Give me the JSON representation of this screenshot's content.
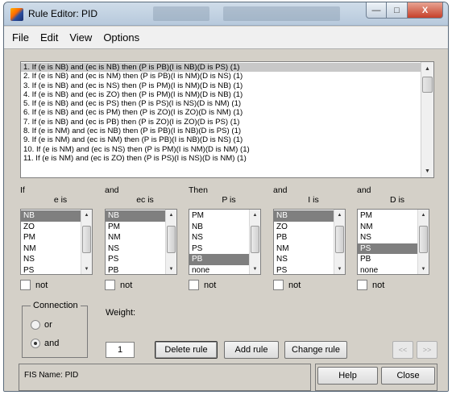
{
  "window": {
    "title": "Rule Editor: PID",
    "buttons": {
      "minimize": "—",
      "maximize": "□",
      "close": "X"
    }
  },
  "menu": [
    "File",
    "Edit",
    "View",
    "Options"
  ],
  "rules": [
    "1. If (e is NB) and (ec is NB) then (P is PB)(I is NB)(D is PS) (1)",
    "2. If (e is NB) and (ec is NM) then (P is PB)(I is NM)(D is NS) (1)",
    "3. If (e is NB) and (ec is NS) then (P is PM)(I is NM)(D is NB) (1)",
    "4. If (e is NB) and (ec is ZO) then (P is PM)(I is NM)(D is NB) (1)",
    "5. If (e is NB) and (ec is PS) then (P is PS)(I is NS)(D is NM) (1)",
    "6. If (e is NB) and (ec is PM) then (P is ZO)(I is ZO)(D is NM) (1)",
    "7. If (e is NB) and (ec is PB) then (P is ZO)(I is ZO)(D is PS) (1)",
    "8. If (e is NM) and (ec is NB) then (P is PB)(I is NB)(D is PS) (1)",
    "9. If (e is NM) and (ec is NM) then (P is PB)(I is NB)(D is NS) (1)",
    "10. If (e is NM) and (ec is NS) then (P is PM)(I is NM)(D is NM) (1)",
    "11. If (e is NM) and (ec is ZO) then (P is PS)(I is NS)(D is NM) (1)"
  ],
  "columns": [
    {
      "head1": "If",
      "head2": "e is",
      "items": [
        "NB",
        "ZO",
        "PM",
        "NM",
        "NS",
        "PS"
      ],
      "selected": 0
    },
    {
      "head1": "and",
      "head2": "ec is",
      "items": [
        "NB",
        "PM",
        "NM",
        "NS",
        "PS",
        "PB"
      ],
      "selected": 0
    },
    {
      "head1": "Then",
      "head2": "P is",
      "items": [
        "PM",
        "NB",
        "NS",
        "PS",
        "PB",
        "none"
      ],
      "selected": 4
    },
    {
      "head1": "and",
      "head2": "I is",
      "items": [
        "NB",
        "ZO",
        "PB",
        "NM",
        "NS",
        "PS"
      ],
      "selected": 0
    },
    {
      "head1": "and",
      "head2": "D is",
      "items": [
        "PM",
        "NM",
        "NS",
        "PS",
        "PB",
        "none"
      ],
      "selected": 3
    }
  ],
  "not_label": "not",
  "connection": {
    "title": "Connection",
    "options": [
      "or",
      "and"
    ],
    "selected": "and"
  },
  "weight": {
    "label": "Weight:",
    "value": "1"
  },
  "buttons": {
    "delete": "Delete rule",
    "add": "Add rule",
    "change": "Change rule",
    "prev": "<<",
    "next": ">>",
    "help": "Help",
    "close": "Close"
  },
  "status": "FIS Name: PID"
}
